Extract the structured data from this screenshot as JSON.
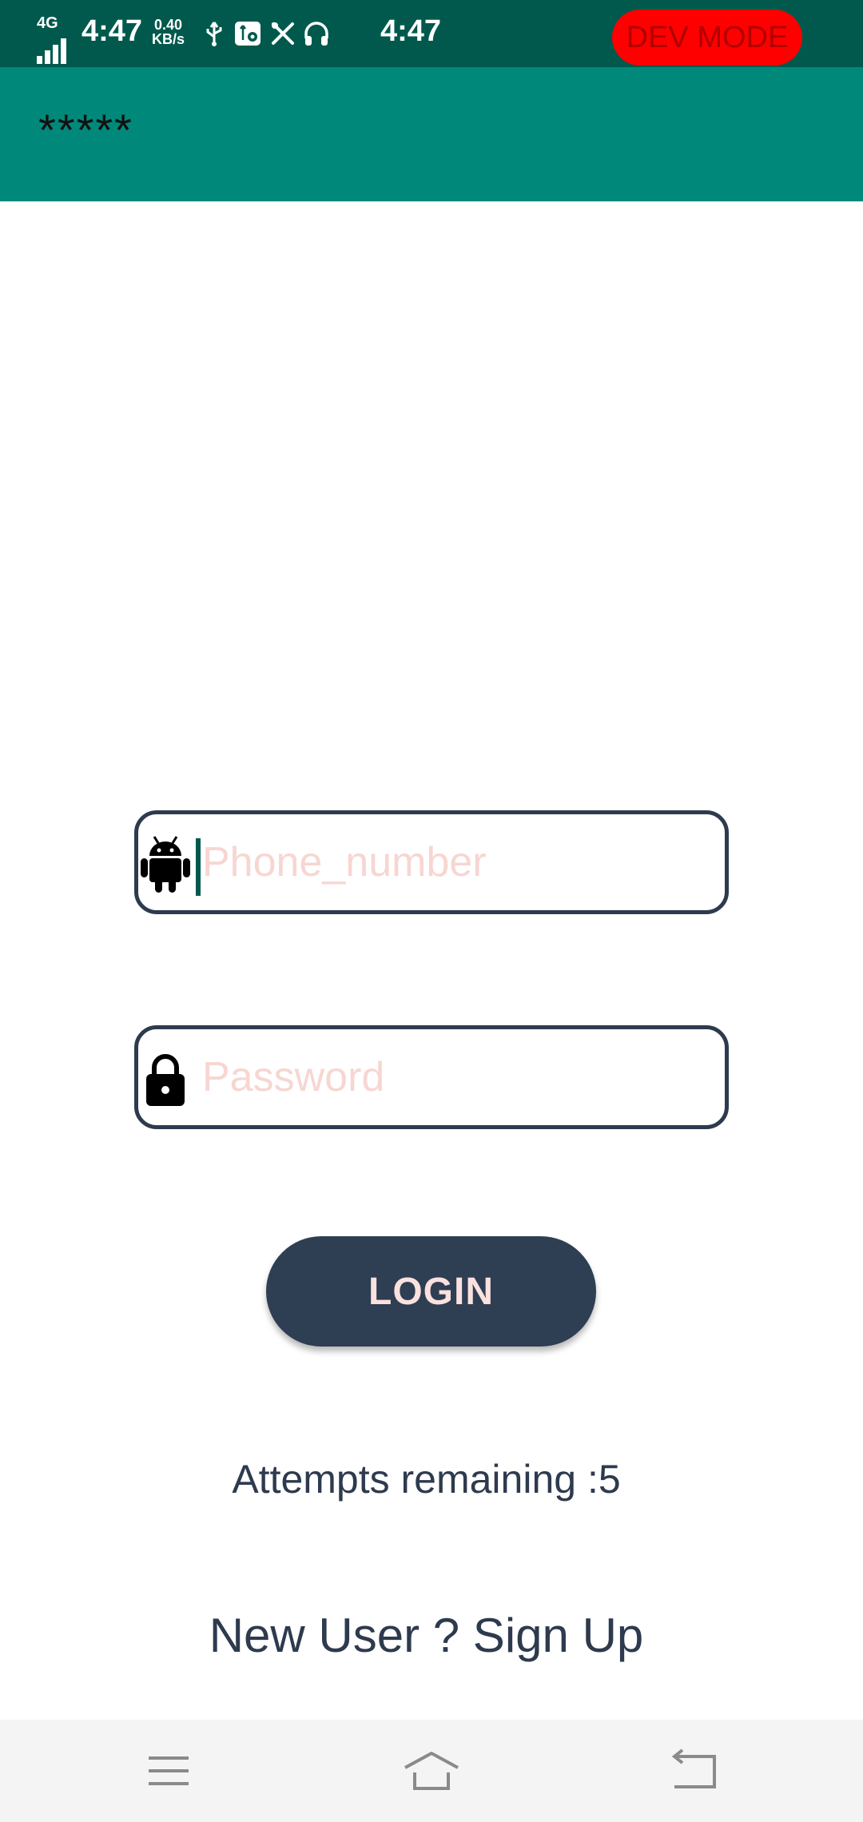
{
  "status_bar": {
    "network": "4G",
    "time_left": "4:47",
    "speed_value": "0.40",
    "speed_unit": "KB/s",
    "time_center": "4:47",
    "dev_mode_label": "DEV MODE",
    "icons": [
      "usb-icon",
      "usb-debug-icon",
      "tools-icon",
      "headphones-icon"
    ]
  },
  "app_bar": {
    "title": "*****"
  },
  "login_form": {
    "phone_placeholder": "Phone_number",
    "phone_value": "",
    "phone_icon": "android-icon",
    "password_placeholder": "Password",
    "password_value": "",
    "password_icon": "lock-icon",
    "login_label": "LOGIN",
    "attempts_text": "Attempts remaining :5",
    "signup_text": "New User ? Sign Up"
  },
  "colors": {
    "status_bar": "#00594c",
    "app_bar": "#00897b",
    "dev_badge": "#ff0000",
    "button": "#2e3e53",
    "placeholder": "#f7d6d2",
    "text": "#2e3a4e"
  },
  "nav_bar": {
    "icons": [
      "menu-icon",
      "home-icon",
      "back-icon"
    ]
  }
}
